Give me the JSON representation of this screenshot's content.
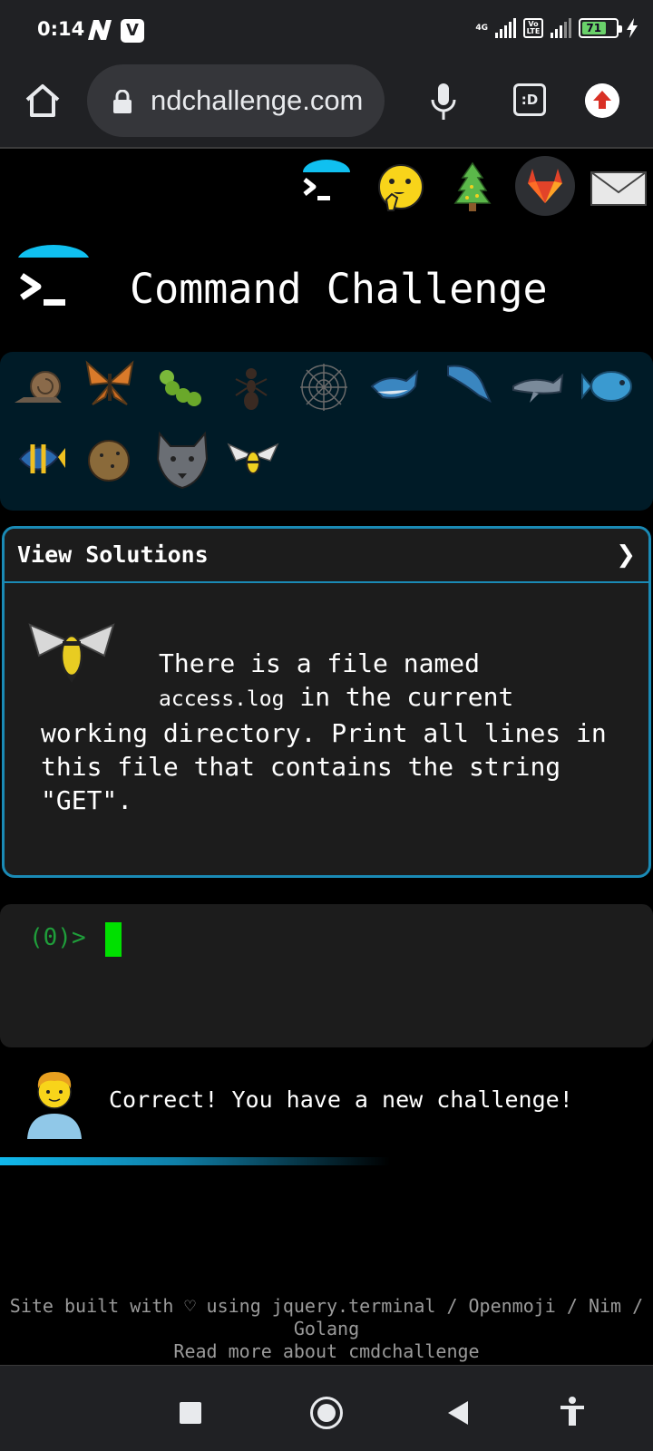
{
  "status_bar": {
    "time": "0:14",
    "n_badge": "N",
    "v_badge": "V",
    "network_tag": "4G",
    "volte_tag": "Vo LTE",
    "battery_level": "71",
    "colors": {
      "battery": "#6ad16a"
    }
  },
  "browser": {
    "url": "ndchallenge.com",
    "tabs_label": ":D",
    "icons": [
      "home-icon",
      "lock-icon",
      "mic-icon",
      "tab-switcher-icon",
      "update-icon"
    ]
  },
  "top_icons": [
    "terminal-umbrella-icon",
    "shushing-face-icon",
    "christmas-tree-icon",
    "gitlab-icon",
    "mail-icon"
  ],
  "site": {
    "title": "Command Challenge"
  },
  "creatures": [
    "snail",
    "butterfly",
    "caterpillar",
    "ant",
    "spider-web",
    "whale",
    "dolphin-leaping",
    "dolphin",
    "fish",
    "tropical-fish",
    "blowfish",
    "wolf",
    "honeybee"
  ],
  "solutions": {
    "header": "View Solutions",
    "chevron": "❯",
    "text_part1": "There is a file named",
    "code": "access.log",
    "text_part2": " in the current working directory. Print all lines in this file that contains the string \"GET\"."
  },
  "terminal": {
    "prompt": "(0)>"
  },
  "result": {
    "message": "Correct! You have a new challenge!"
  },
  "footer": {
    "line1": "Site built with ♡ using jquery.terminal / Openmoji / Nim / Golang",
    "line2": "Read more about cmdchallenge"
  },
  "colors": {
    "accent": "#1a8ab5",
    "prompt_green": "#1f9e3a",
    "cursor_green": "#00e000",
    "progress": "#11b8ec"
  }
}
